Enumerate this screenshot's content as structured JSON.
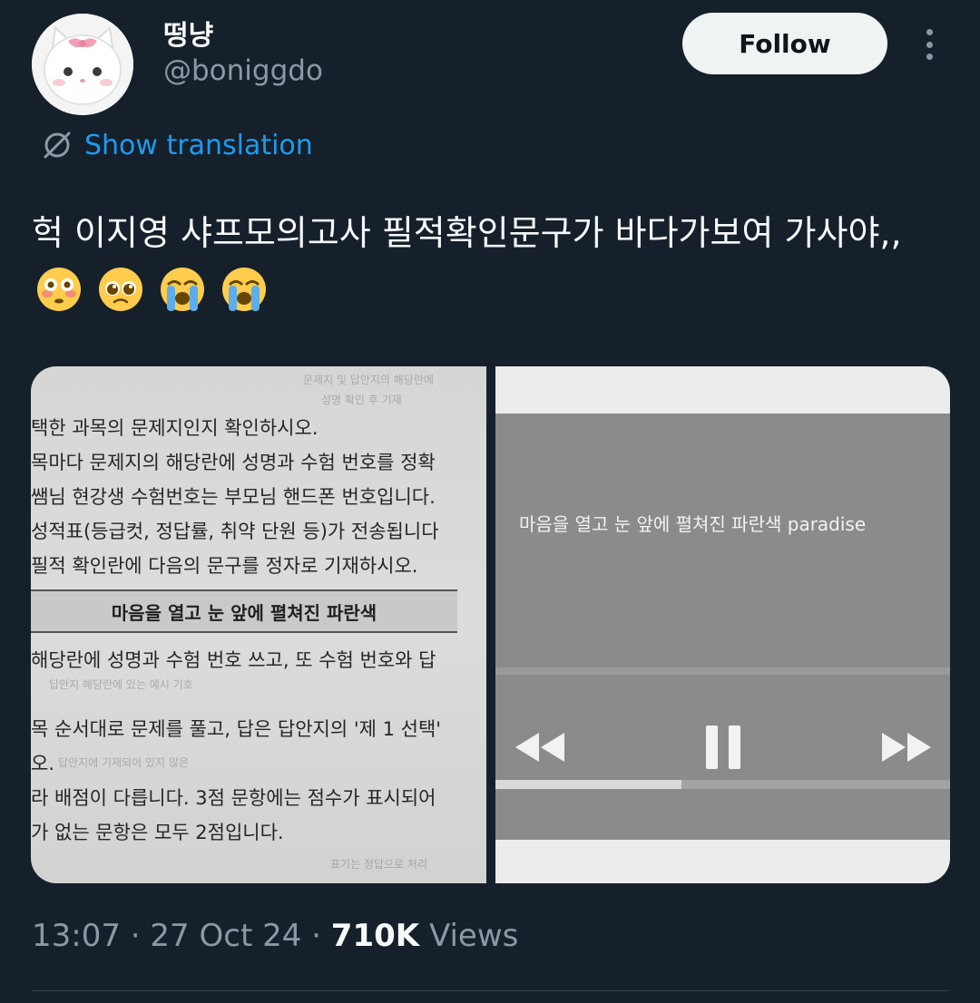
{
  "author": {
    "display_name": "떵냥",
    "handle": "@boniggdo",
    "avatar": "white-cat-plush-avatar"
  },
  "actions": {
    "follow_label": "Follow",
    "more_icon": "more-vertical-icon"
  },
  "translation": {
    "label": "Show translation",
    "icon": "translate-icon"
  },
  "tweet": {
    "text": "헉 이지영 샤프모의고사 필적확인문구가 바다가보여 가사야,,",
    "emojis": [
      "flushed-face",
      "pleading-face",
      "loudly-crying-face",
      "loudly-crying-face"
    ]
  },
  "media": {
    "left_photo": {
      "lines": [
        "택한 과목의 문제지인지 확인하시오.",
        "목마다 문제지의 해당란에 성명과 수험 번호를 정확",
        "쌤님 현강생 수험번호는 부모님 핸드폰 번호입니다.",
        "성적표(등급컷, 정답률, 취약 단원 등)가 전송됩니다",
        "필적 확인란에 다음의 문구를 정자로 기재하시오."
      ],
      "highlight": "마음을 열고 눈 앞에 펼쳐진 파란색",
      "lines_after": [
        "해당란에 성명과 수험 번호 쓰고, 또 수험 번호와 답",
        "목 순서대로 문제를 풀고, 답은 답안지의 '제 1 선택'",
        "오.",
        "라 배점이 다릅니다. 3점 문항에는 점수가 표시되어",
        "가 없는 문항은 모두 2점입니다."
      ]
    },
    "right_photo": {
      "lyric": "마음을 열고 눈 앞에 펼쳐진 파란색 paradise",
      "progress": 0.41,
      "controls": [
        "rewind-icon",
        "pause-icon",
        "fast-forward-icon"
      ]
    }
  },
  "meta": {
    "time": "13:07",
    "date": "27 Oct 24",
    "separator": "·",
    "views_count": "710K",
    "views_label": "Views"
  }
}
